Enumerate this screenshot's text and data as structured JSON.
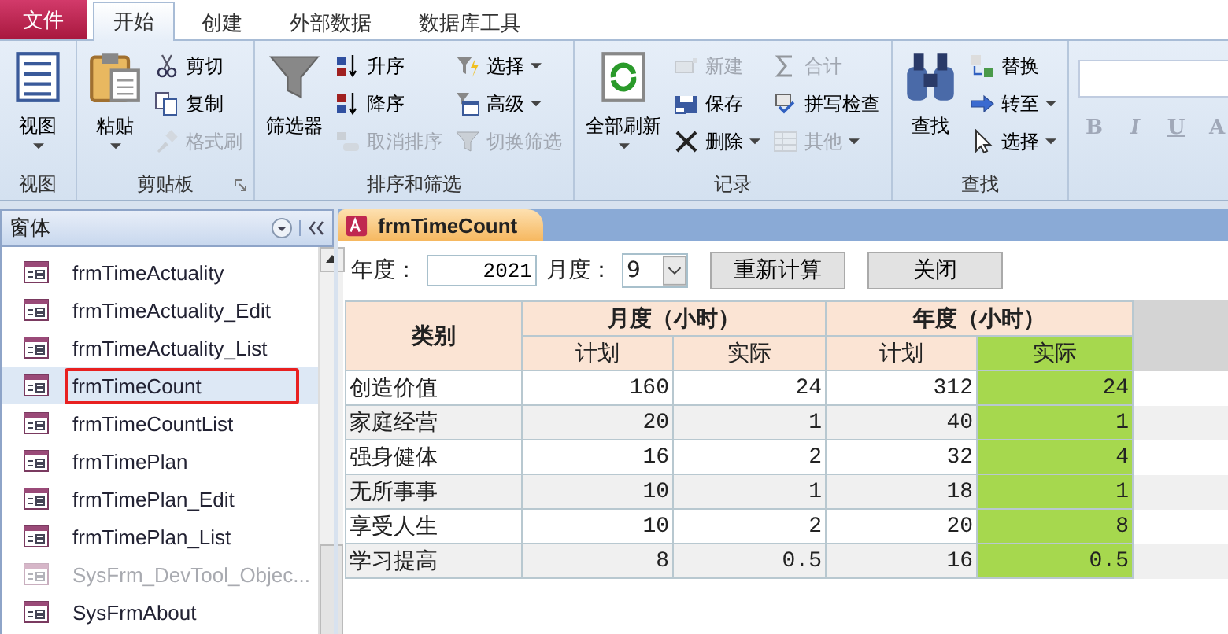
{
  "file_tab": "文件",
  "ribbon_tabs": [
    {
      "label": "开始",
      "selected": true
    },
    {
      "label": "创建",
      "selected": false
    },
    {
      "label": "外部数据",
      "selected": false
    },
    {
      "label": "数据库工具",
      "selected": false
    }
  ],
  "ribbon_groups": [
    {
      "label": "视图",
      "launcher": false,
      "items": [
        {
          "kind": "large",
          "label": "视图",
          "dropdown": true,
          "disabled": false
        }
      ]
    },
    {
      "label": "剪贴板",
      "launcher": true,
      "items": [
        {
          "kind": "large",
          "label": "粘贴",
          "dropdown": true,
          "disabled": false
        },
        {
          "kind": "small",
          "label": "剪切",
          "dropdown": false,
          "disabled": false
        },
        {
          "kind": "small",
          "label": "复制",
          "dropdown": false,
          "disabled": false
        },
        {
          "kind": "small",
          "label": "格式刷",
          "dropdown": false,
          "disabled": true
        }
      ]
    },
    {
      "label": "排序和筛选",
      "launcher": false,
      "items": [
        {
          "kind": "large",
          "label": "筛选器",
          "dropdown": false,
          "disabled": false
        },
        {
          "kind": "small",
          "label": "升序",
          "dropdown": false,
          "disabled": false
        },
        {
          "kind": "small",
          "label": "降序",
          "dropdown": false,
          "disabled": false
        },
        {
          "kind": "small",
          "label": "取消排序",
          "dropdown": false,
          "disabled": true
        },
        {
          "kind": "small",
          "label": "选择",
          "dropdown": true,
          "disabled": false
        },
        {
          "kind": "small",
          "label": "高级",
          "dropdown": true,
          "disabled": false
        },
        {
          "kind": "small",
          "label": "切换筛选",
          "dropdown": false,
          "disabled": true
        }
      ]
    },
    {
      "label": "记录",
      "launcher": false,
      "items": [
        {
          "kind": "large",
          "label": "全部刷新",
          "dropdown": true,
          "disabled": false
        },
        {
          "kind": "small",
          "label": "新建",
          "dropdown": false,
          "disabled": true
        },
        {
          "kind": "small",
          "label": "保存",
          "dropdown": false,
          "disabled": false
        },
        {
          "kind": "small",
          "label": "删除",
          "dropdown": true,
          "disabled": false
        },
        {
          "kind": "small",
          "label": "合计",
          "dropdown": false,
          "disabled": true
        },
        {
          "kind": "small",
          "label": "拼写检查",
          "dropdown": false,
          "disabled": false
        },
        {
          "kind": "small",
          "label": "其他",
          "dropdown": true,
          "disabled": true
        }
      ]
    },
    {
      "label": "查找",
      "launcher": false,
      "items": [
        {
          "kind": "large",
          "label": "查找",
          "dropdown": false,
          "disabled": false
        },
        {
          "kind": "small",
          "label": "替换",
          "dropdown": false,
          "disabled": false
        },
        {
          "kind": "small",
          "label": "转至",
          "dropdown": true,
          "disabled": false
        },
        {
          "kind": "small",
          "label": "选择",
          "dropdown": true,
          "disabled": false
        }
      ]
    }
  ],
  "format_buttons": [
    {
      "label": "B",
      "disabled": true
    },
    {
      "label": "I",
      "disabled": true
    },
    {
      "label": "U",
      "disabled": true
    },
    {
      "label": "A",
      "disabled": true
    }
  ],
  "nav_pane": {
    "title": "窗体",
    "items": [
      {
        "label": "frmTimeActuality",
        "selected": false,
        "disabled": false,
        "highlighted": false
      },
      {
        "label": "frmTimeActuality_Edit",
        "selected": false,
        "disabled": false,
        "highlighted": false
      },
      {
        "label": "frmTimeActuality_List",
        "selected": false,
        "disabled": false,
        "highlighted": false
      },
      {
        "label": "frmTimeCount",
        "selected": true,
        "disabled": false,
        "highlighted": true
      },
      {
        "label": "frmTimeCountList",
        "selected": false,
        "disabled": false,
        "highlighted": false
      },
      {
        "label": "frmTimePlan",
        "selected": false,
        "disabled": false,
        "highlighted": false
      },
      {
        "label": "frmTimePlan_Edit",
        "selected": false,
        "disabled": false,
        "highlighted": false
      },
      {
        "label": "frmTimePlan_List",
        "selected": false,
        "disabled": false,
        "highlighted": false
      },
      {
        "label": "SysFrm_DevTool_Objec...",
        "selected": false,
        "disabled": true,
        "highlighted": false
      },
      {
        "label": "SysFrmAbout",
        "selected": false,
        "disabled": false,
        "highlighted": false
      }
    ]
  },
  "document_tab": {
    "label": "frmTimeCount"
  },
  "form": {
    "year_label": "年度：",
    "year_value": "2021",
    "month_label": "月度：",
    "month_value": "9",
    "buttons": [
      "重新计算",
      "关闭"
    ]
  },
  "table": {
    "category_header": "类别",
    "groups": [
      {
        "label": "月度（小时）",
        "columns": [
          {
            "label": "计划",
            "highlighted": false
          },
          {
            "label": "实际",
            "highlighted": false
          }
        ]
      },
      {
        "label": "年度（小时）",
        "columns": [
          {
            "label": "计划",
            "highlighted": false
          },
          {
            "label": "实际",
            "highlighted": true
          }
        ]
      }
    ],
    "rows": [
      {
        "category": "创造价值",
        "values": [
          "160",
          "24",
          "312",
          "24"
        ]
      },
      {
        "category": "家庭经营",
        "values": [
          "20",
          "1",
          "40",
          "1"
        ]
      },
      {
        "category": "强身健体",
        "values": [
          "16",
          "2",
          "32",
          "4"
        ]
      },
      {
        "category": "无所事事",
        "values": [
          "10",
          "1",
          "18",
          "1"
        ]
      },
      {
        "category": "享受人生",
        "values": [
          "10",
          "2",
          "20",
          "8"
        ]
      },
      {
        "category": "学习提高",
        "values": [
          "8",
          "0.5",
          "16",
          "0.5"
        ]
      }
    ]
  }
}
